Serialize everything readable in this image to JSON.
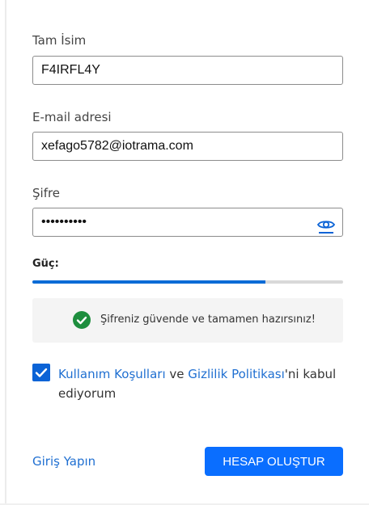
{
  "form": {
    "full_name": {
      "label": "Tam İsim",
      "value": "F4IRFL4Y"
    },
    "email": {
      "label": "E-mail adresi",
      "value": "xefago5782@iotrama.com"
    },
    "password": {
      "label": "Şifre",
      "value": "••••••••••",
      "toggle_icon": "eye-icon"
    },
    "strength": {
      "label": "Güç:",
      "level": 0.75,
      "color": "#0b6bd6"
    },
    "notice": {
      "icon": "check-circle-icon",
      "text": "Şifreniz güvende ve tamamen hazırsınız!",
      "icon_color": "#1e8e3e"
    },
    "terms": {
      "checked": true,
      "link1": "Kullanım Koşulları",
      "conj": " ve ",
      "link2": "Gizlilik Politikası",
      "suffix": "'ni kabul ediyorum"
    },
    "login_link": "Giriş Yapın",
    "submit_label": "HESAP OLUŞTUR"
  },
  "colors": {
    "accent": "#0a6eff",
    "link": "#1f6fd1"
  }
}
